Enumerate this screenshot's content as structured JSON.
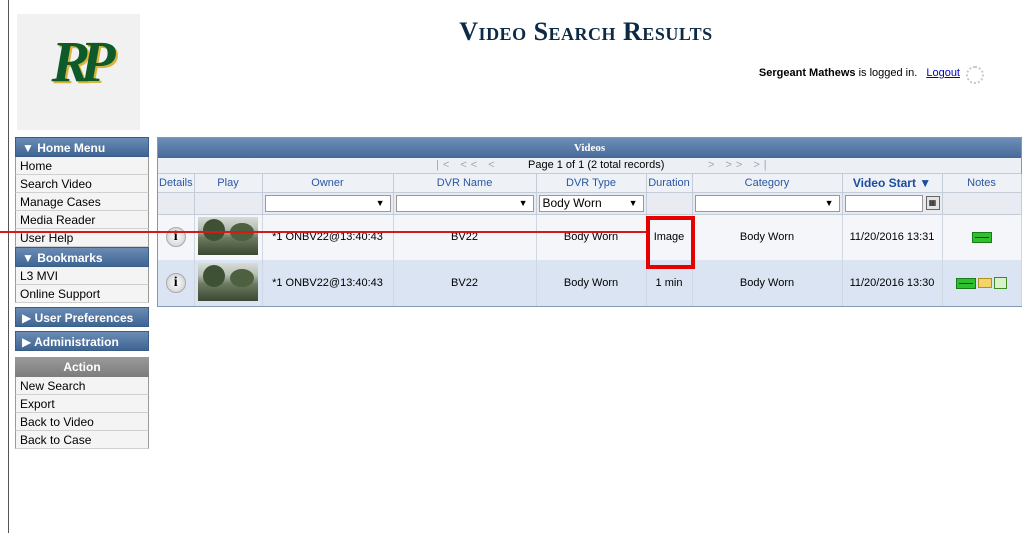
{
  "header": {
    "logo_text": "RP",
    "title": "Video Search Results",
    "user_name": "Sergeant Mathews",
    "logged_in_text": "is logged in.",
    "logout_label": "Logout"
  },
  "sidebar": {
    "home_menu": {
      "title": "▼ Home Menu",
      "items": [
        "Home",
        "Search Video",
        "Manage Cases",
        "Media Reader",
        "User Help"
      ]
    },
    "bookmarks": {
      "title": "▼  Bookmarks",
      "items": [
        "L3 MVI",
        "Online Support"
      ]
    },
    "user_preferences": {
      "title": "▶ User Preferences"
    },
    "administration": {
      "title": "▶  Administration"
    },
    "action": {
      "title": "Action",
      "items": [
        "New Search",
        "Export",
        "Back to Video",
        "Back to Case"
      ]
    }
  },
  "grid": {
    "title": "Videos",
    "pager_info": "Page 1 of 1 (2 total records)",
    "nav_left": "|< << <",
    "nav_right": "> >> >|",
    "columns": [
      "Details",
      "Play",
      "Owner",
      "DVR Name",
      "DVR Type",
      "Duration",
      "Category",
      "Video Start ▼",
      "Notes"
    ],
    "filters": {
      "dvr_type": "Body Worn"
    },
    "rows": [
      {
        "owner": "*1 ONBV22@13:40:43",
        "dvr_name": "BV22",
        "dvr_type": "Body Worn",
        "duration": "Image",
        "category": "Body Worn",
        "video_start": "11/20/2016 13:31"
      },
      {
        "owner": "*1 ONBV22@13:40:43",
        "dvr_name": "BV22",
        "dvr_type": "Body Worn",
        "duration": "1 min",
        "category": "Body Worn",
        "video_start": "11/20/2016 13:30"
      }
    ]
  },
  "icons": {
    "info": "info-icon",
    "thumbnail": "video-thumbnail",
    "note": "note-icon",
    "folder": "folder-icon",
    "copy": "copy-icon"
  },
  "colors": {
    "header_blue": "#46699a",
    "title_navy": "#0c2a44",
    "highlight_red": "#e60000",
    "logo_green": "#0f5a2a"
  }
}
